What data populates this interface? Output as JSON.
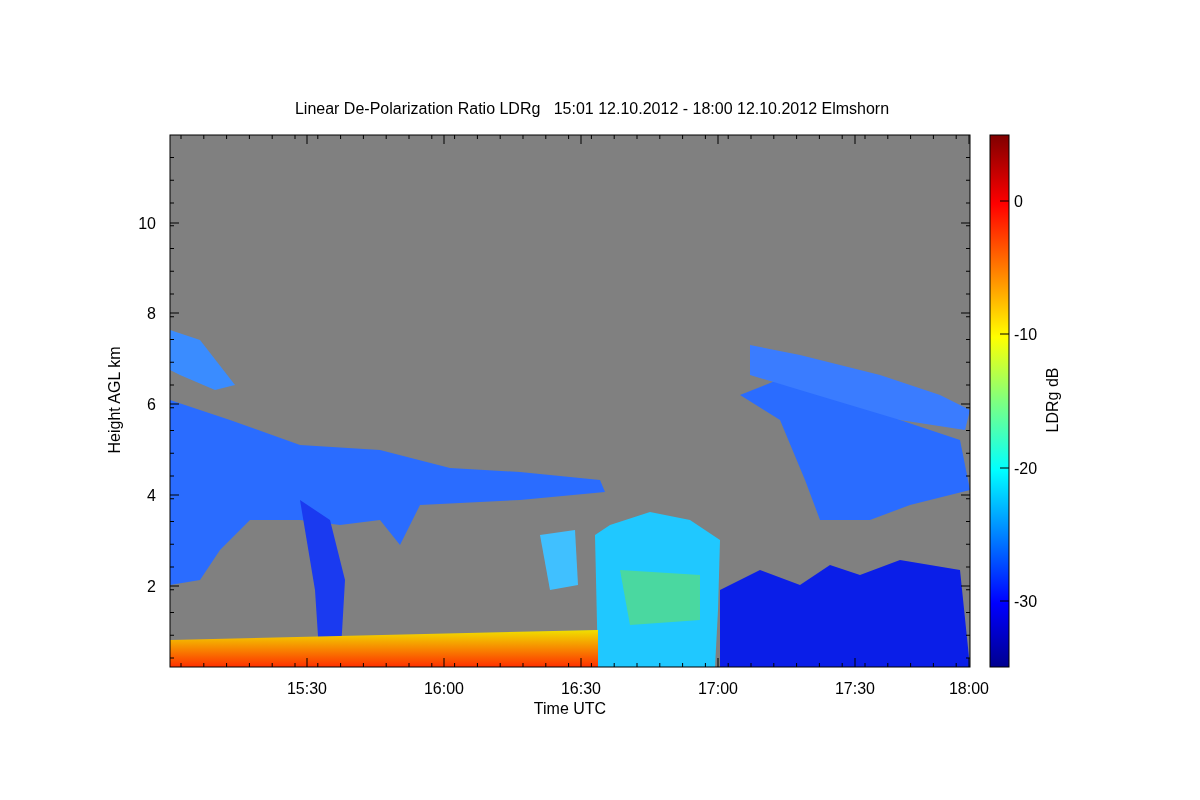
{
  "title": "Linear De-Polarization Ratio LDRg   15:01 12.10.2012 - 18:00 12.10.2012 Elmshorn",
  "x_axis": {
    "label": "Time UTC",
    "ticks": [
      "15:30",
      "16:00",
      "16:30",
      "17:00",
      "17:30",
      "18:00"
    ]
  },
  "y_axis": {
    "label": "Height AGL km",
    "ticks": [
      "10",
      "8",
      "6",
      "4",
      "2"
    ]
  },
  "colorbar": {
    "label": "LDRg dB",
    "ticks": [
      "0",
      "-10",
      "-20",
      "-30"
    ]
  }
}
